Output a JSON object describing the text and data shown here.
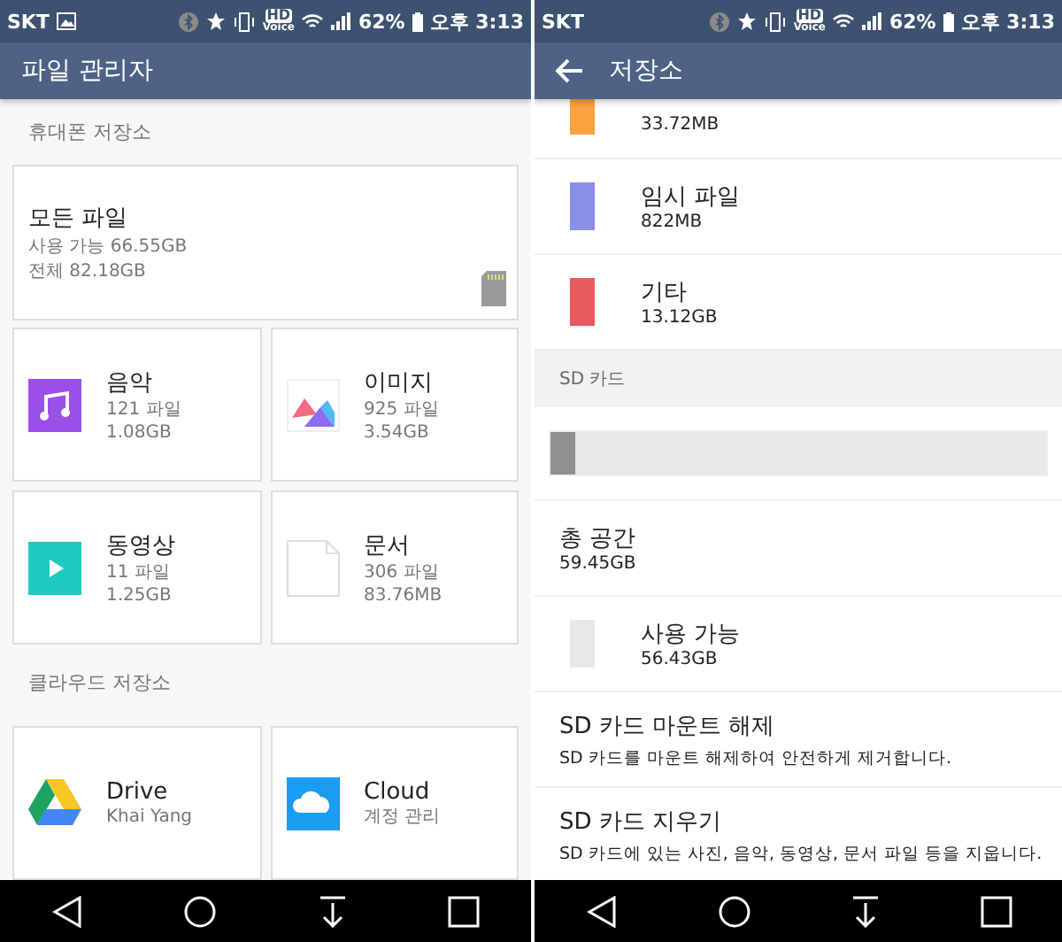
{
  "left_screen": {
    "status_bar": {
      "carrier": "SKT",
      "gallery_icon": true,
      "hd": "HD",
      "voice": "Voice",
      "battery": "62%",
      "time": "오후 3:13"
    },
    "app_bar": {
      "title": "파일 관리자",
      "back": false
    },
    "phone_header": "휴대폰 저장소",
    "all_files": {
      "title": "모든 파일",
      "available": "사용 가능 66.55GB",
      "total": "전체 82.18GB"
    },
    "categories": [
      {
        "kind": "music",
        "name": "음악",
        "count": "121 파일",
        "size": "1.08GB"
      },
      {
        "kind": "image",
        "name": "이미지",
        "count": "925 파일",
        "size": "3.54GB"
      },
      {
        "kind": "video",
        "name": "동영상",
        "count": "11 파일",
        "size": "1.25GB"
      },
      {
        "kind": "document",
        "name": "문서",
        "count": "306 파일",
        "size": "83.76MB"
      }
    ],
    "cloud_header": "클라우드 저장소",
    "cloud": [
      {
        "kind": "drive",
        "name": "Drive",
        "subtitle": "Khai Yang"
      },
      {
        "kind": "cloud",
        "name": "Cloud",
        "subtitle": "계정 관리"
      }
    ]
  },
  "right_screen": {
    "status_bar": {
      "carrier": "SKT",
      "gallery_icon": false,
      "hd": "HD",
      "voice": "Voice",
      "battery": "62%",
      "time": "오후 3:13"
    },
    "app_bar": {
      "title": "저장소",
      "back": true
    },
    "items": [
      {
        "size": "33.72MB",
        "color": "#f9a23f"
      },
      {
        "label": "임시 파일",
        "size": "822MB",
        "color": "#8a8ee8"
      },
      {
        "label": "기타",
        "size": "13.12GB",
        "color": "#e85a5e"
      }
    ],
    "sd_header": "SD 카드",
    "sd_bar": {
      "level": 0.05
    },
    "total": {
      "title": "총 공간",
      "value": "59.45GB"
    },
    "available": {
      "label": "사용 가능",
      "size": "56.43GB",
      "color": "#e8e8e8"
    },
    "actions": [
      {
        "title": "SD 카드 마운트 해제",
        "description": "SD 카드를 마운트 해제하여 안전하게 제거합니다."
      },
      {
        "title": "SD 카드 지우기",
        "description": "SD 카드에 있는 사진, 음악, 동영상, 문서 파일 등을 지웁니다."
      }
    ]
  }
}
